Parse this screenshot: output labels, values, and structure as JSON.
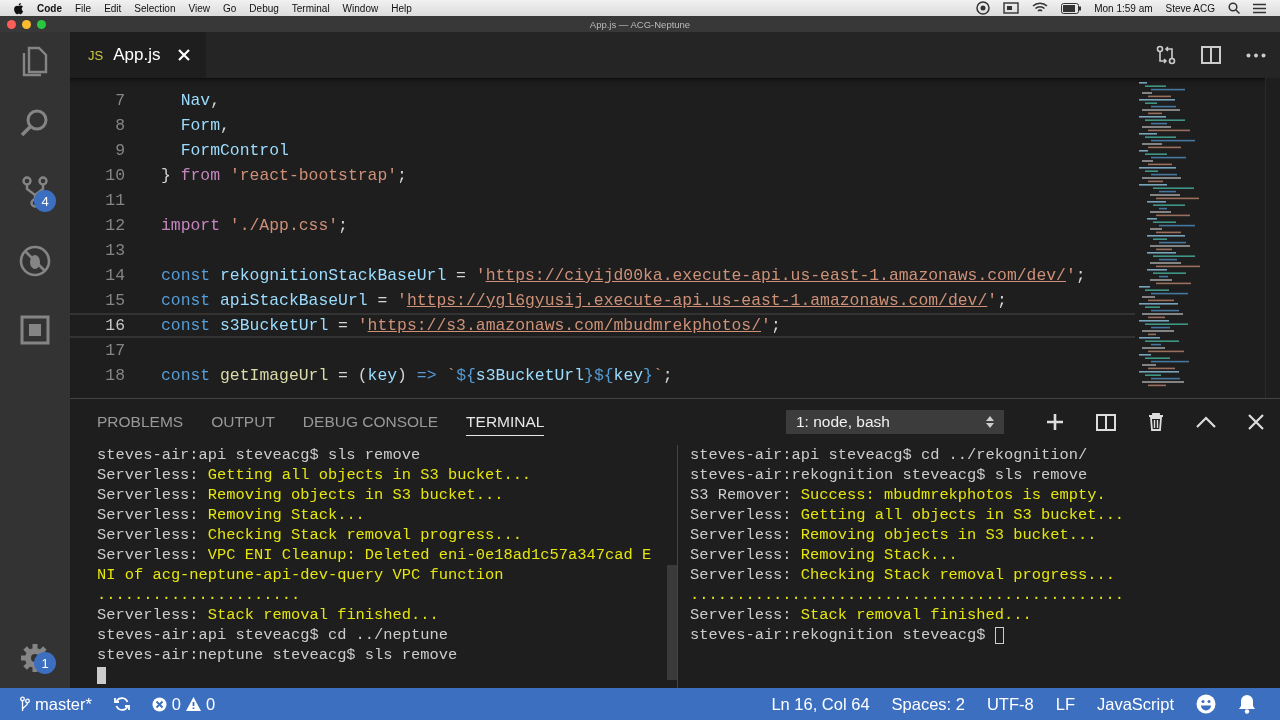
{
  "menubar": {
    "app": "Code",
    "menus": [
      "File",
      "Edit",
      "Selection",
      "View",
      "Go",
      "Debug",
      "Terminal",
      "Window",
      "Help"
    ],
    "clock": "Mon 1:59 am",
    "user": "Steve ACG"
  },
  "window": {
    "title": "App.js — ACG-Neptune"
  },
  "activity_bar": {
    "items": [
      {
        "kind": "files"
      },
      {
        "kind": "search"
      },
      {
        "kind": "scm",
        "badge": "4"
      },
      {
        "kind": "debug"
      },
      {
        "kind": "extensions"
      }
    ],
    "settings_badge": "1"
  },
  "tabs": [
    {
      "icon": "JS",
      "label": "App.js",
      "selected": true
    }
  ],
  "editor": {
    "lines": [
      {
        "number": "7",
        "current": false,
        "tokens": [
          {
            "kind": "var",
            "text": "  Nav"
          },
          {
            "kind": "plain",
            "text": ","
          }
        ]
      },
      {
        "number": "8",
        "current": false,
        "tokens": [
          {
            "kind": "var",
            "text": "  Form"
          },
          {
            "kind": "plain",
            "text": ","
          }
        ]
      },
      {
        "number": "9",
        "current": false,
        "tokens": [
          {
            "kind": "var",
            "text": "  FormControl"
          }
        ]
      },
      {
        "number": "10",
        "current": false,
        "tokens": [
          {
            "kind": "plain",
            "text": "} "
          },
          {
            "kind": "ctl",
            "text": "from "
          },
          {
            "kind": "str",
            "text": "'react-bootstrap'"
          },
          {
            "kind": "plain",
            "text": ";"
          }
        ]
      },
      {
        "number": "11",
        "current": false
      },
      {
        "number": "12",
        "current": false,
        "tokens": [
          {
            "kind": "ctl",
            "text": "import "
          },
          {
            "kind": "str",
            "text": "'./App.css'"
          },
          {
            "kind": "plain",
            "text": ";"
          }
        ]
      },
      {
        "number": "13",
        "current": false
      },
      {
        "number": "14",
        "current": false,
        "tokens": [
          {
            "kind": "kw",
            "text": "const "
          },
          {
            "kind": "var",
            "text": "rekognitionStackBaseUrl"
          },
          {
            "kind": "plain",
            "text": " = "
          },
          {
            "kind": "str",
            "text": "'"
          },
          {
            "kind": "url",
            "text": "https://ciyijd00ka.execute-api.us-east-1.amazonaws.com/dev/"
          },
          {
            "kind": "str",
            "text": "'"
          },
          {
            "kind": "plain",
            "text": ";"
          }
        ]
      },
      {
        "number": "15",
        "current": false,
        "tokens": [
          {
            "kind": "kw",
            "text": "const "
          },
          {
            "kind": "var",
            "text": "apiStackBaseUrl"
          },
          {
            "kind": "plain",
            "text": " = "
          },
          {
            "kind": "str",
            "text": "'"
          },
          {
            "kind": "url",
            "text": "https://ygl6gyusij.execute-api.us-east-1.amazonaws.com/dev/"
          },
          {
            "kind": "str",
            "text": "'"
          },
          {
            "kind": "plain",
            "text": ";"
          }
        ]
      },
      {
        "number": "16",
        "current": true,
        "tokens": [
          {
            "kind": "kw",
            "text": "const "
          },
          {
            "kind": "var",
            "text": "s3BucketUrl"
          },
          {
            "kind": "plain",
            "text": " = "
          },
          {
            "kind": "str",
            "text": "'"
          },
          {
            "kind": "url",
            "text": "https://s3.amazonaws.com/mbudmrekphotos/"
          },
          {
            "kind": "str",
            "text": "'"
          },
          {
            "kind": "plain",
            "text": ";"
          }
        ]
      },
      {
        "number": "17",
        "current": false
      },
      {
        "number": "18",
        "current": false,
        "tokens": [
          {
            "kind": "kw",
            "text": "const "
          },
          {
            "kind": "fn",
            "text": "getImageUrl"
          },
          {
            "kind": "plain",
            "text": " = ("
          },
          {
            "kind": "var",
            "text": "key"
          },
          {
            "kind": "plain",
            "text": ") "
          },
          {
            "kind": "kw",
            "text": "=> "
          },
          {
            "kind": "str",
            "text": "`"
          },
          {
            "kind": "kw",
            "text": "${"
          },
          {
            "kind": "var",
            "text": "s3BucketUrl"
          },
          {
            "kind": "kw",
            "text": "}${"
          },
          {
            "kind": "var",
            "text": "key"
          },
          {
            "kind": "kw",
            "text": "}"
          },
          {
            "kind": "str",
            "text": "`"
          },
          {
            "kind": "plain",
            "text": ";"
          }
        ]
      }
    ]
  },
  "panel": {
    "tabs": [
      {
        "label": "PROBLEMS",
        "selected": false
      },
      {
        "label": "OUTPUT",
        "selected": false
      },
      {
        "label": "DEBUG CONSOLE",
        "selected": false
      },
      {
        "label": "TERMINAL",
        "selected": true
      }
    ],
    "terminal_select": "1: node, bash",
    "panes": [
      {
        "cursor_filled": true,
        "lines": [
          [
            {
              "kind": "plain",
              "text": "steves-air:api steveacg$ sls remove"
            }
          ],
          [
            {
              "kind": "plain",
              "text": "Serverless: "
            },
            {
              "kind": "hl",
              "text": "Getting all objects in S3 bucket..."
            }
          ],
          [
            {
              "kind": "plain",
              "text": "Serverless: "
            },
            {
              "kind": "hl",
              "text": "Removing objects in S3 bucket..."
            }
          ],
          [
            {
              "kind": "plain",
              "text": "Serverless: "
            },
            {
              "kind": "hl",
              "text": "Removing Stack..."
            }
          ],
          [
            {
              "kind": "plain",
              "text": "Serverless: "
            },
            {
              "kind": "hl",
              "text": "Checking Stack removal progress..."
            }
          ],
          [
            {
              "kind": "plain",
              "text": "Serverless: "
            },
            {
              "kind": "hl",
              "text": "VPC ENI Cleanup: Deleted eni-0e18ad1c57a347cad E"
            }
          ],
          [
            {
              "kind": "hl",
              "text": "NI of acg-neptune-api-dev-query VPC function"
            }
          ],
          [
            {
              "kind": "hl",
              "text": "......................"
            }
          ],
          [
            {
              "kind": "plain",
              "text": "Serverless: "
            },
            {
              "kind": "hl",
              "text": "Stack removal finished..."
            }
          ],
          [
            {
              "kind": "plain",
              "text": "steves-air:api steveacg$ cd ../neptune"
            }
          ],
          [
            {
              "kind": "plain",
              "text": "steves-air:neptune steveacg$ sls remove"
            }
          ]
        ]
      },
      {
        "cursor_filled": false,
        "lines": [
          [
            {
              "kind": "plain",
              "text": "steves-air:api steveacg$ cd ../rekognition/"
            }
          ],
          [
            {
              "kind": "plain",
              "text": "steves-air:rekognition steveacg$ sls remove"
            }
          ],
          [
            {
              "kind": "plain",
              "text": "S3 Remover: "
            },
            {
              "kind": "hl",
              "text": "Success: mbudmrekphotos is empty."
            }
          ],
          [
            {
              "kind": "plain",
              "text": "Serverless: "
            },
            {
              "kind": "hl",
              "text": "Getting all objects in S3 bucket..."
            }
          ],
          [
            {
              "kind": "plain",
              "text": "Serverless: "
            },
            {
              "kind": "hl",
              "text": "Removing objects in S3 bucket..."
            }
          ],
          [
            {
              "kind": "plain",
              "text": "Serverless: "
            },
            {
              "kind": "hl",
              "text": "Removing Stack..."
            }
          ],
          [
            {
              "kind": "plain",
              "text": "Serverless: "
            },
            {
              "kind": "hl",
              "text": "Checking Stack removal progress..."
            }
          ],
          [
            {
              "kind": "hl",
              "text": "..............................................."
            }
          ],
          [
            {
              "kind": "plain",
              "text": "Serverless: "
            },
            {
              "kind": "hl",
              "text": "Stack removal finished..."
            }
          ],
          [
            {
              "kind": "plain",
              "text": "steves-air:rekognition steveacg$ "
            }
          ]
        ]
      }
    ]
  },
  "status_bar": {
    "branch": "master*",
    "errors": "0",
    "warnings": "0",
    "position": "Ln 16, Col 64",
    "indent": "Spaces: 2",
    "encoding": "UTF-8",
    "eol": "LF",
    "language": "JavaScript"
  }
}
